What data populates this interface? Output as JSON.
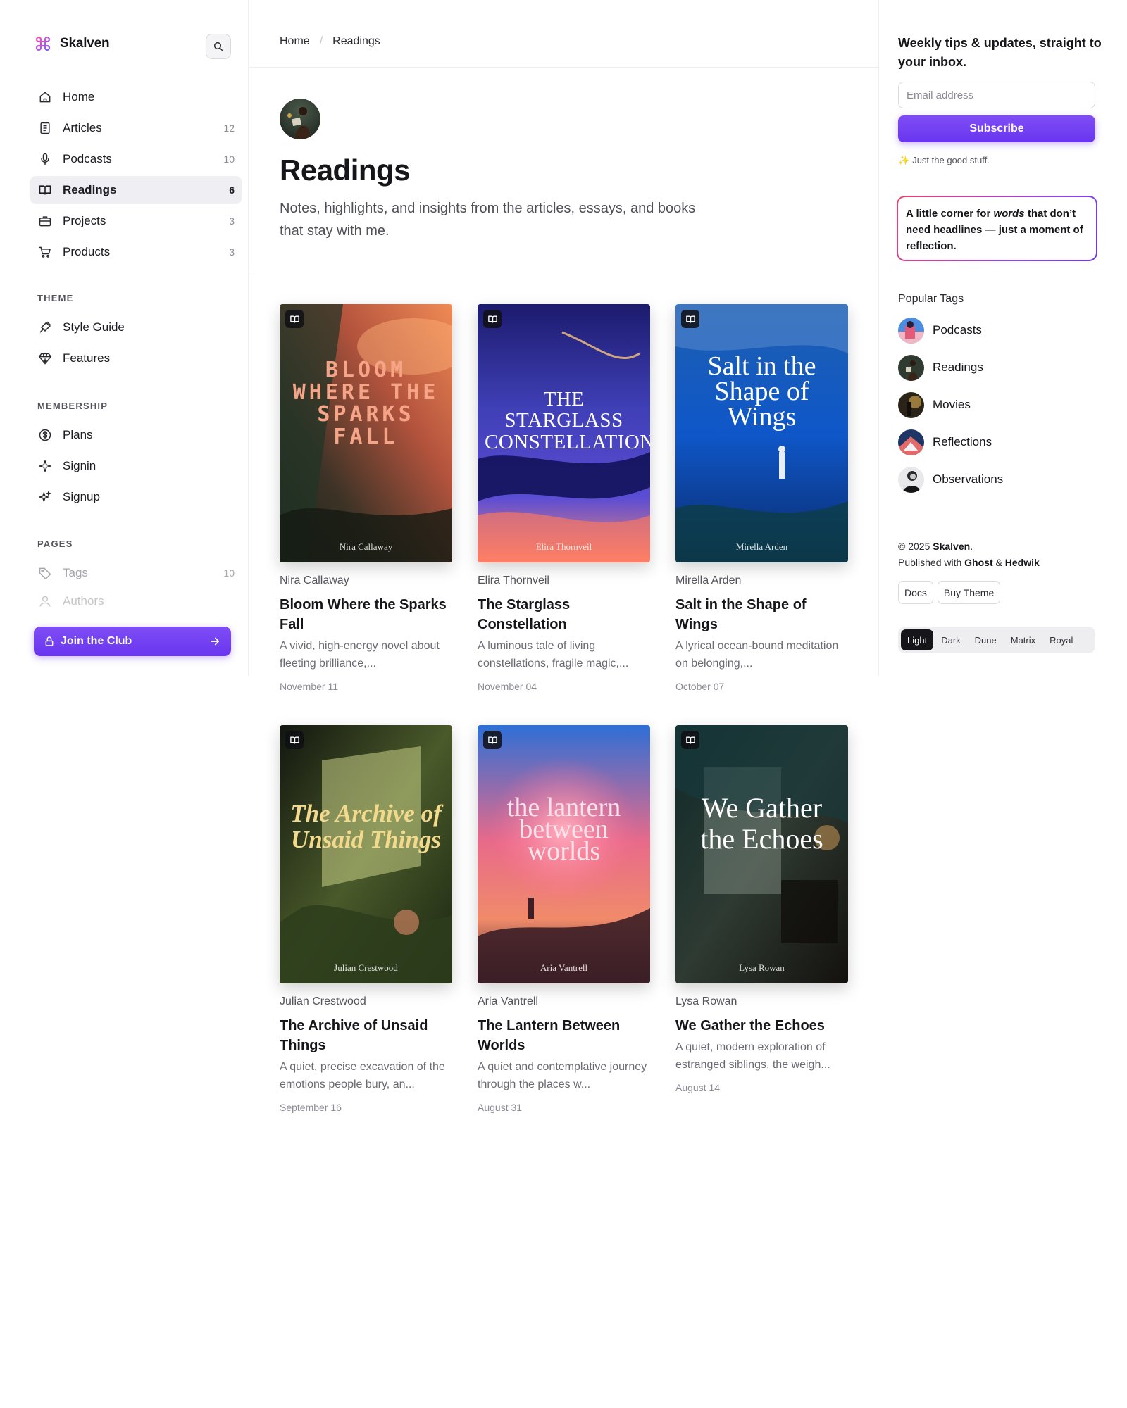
{
  "brand": {
    "name": "Skalven",
    "colors": {
      "accent": "#6a35ef",
      "logo_a": "#ff4fb0",
      "logo_b": "#7b5cff"
    }
  },
  "sidebar": {
    "nav": [
      {
        "label": "Home",
        "count": "",
        "icon": "home-icon",
        "active": false
      },
      {
        "label": "Articles",
        "count": "12",
        "icon": "document-icon",
        "active": false
      },
      {
        "label": "Podcasts",
        "count": "10",
        "icon": "microphone-icon",
        "active": false
      },
      {
        "label": "Readings",
        "count": "6",
        "icon": "book-open-icon",
        "active": true
      },
      {
        "label": "Projects",
        "count": "3",
        "icon": "briefcase-icon",
        "active": false
      },
      {
        "label": "Products",
        "count": "3",
        "icon": "cart-icon",
        "active": false
      }
    ],
    "theme_section": "THEME",
    "theme_items": [
      {
        "label": "Style Guide",
        "icon": "paint-tools-icon"
      },
      {
        "label": "Features",
        "icon": "diamond-icon"
      }
    ],
    "membership_section": "MEMBERSHIP",
    "membership_items": [
      {
        "label": "Plans",
        "icon": "dollar-circle-icon"
      },
      {
        "label": "Signin",
        "icon": "sparkle-icon"
      },
      {
        "label": "Signup",
        "icon": "sparkles-icon"
      }
    ],
    "pages_section": "PAGES",
    "pages_items": [
      {
        "label": "Tags",
        "count": "10",
        "icon": "tag-icon"
      },
      {
        "label": "Authors",
        "count": "",
        "icon": "user-icon"
      }
    ],
    "join_label": "Join the Club"
  },
  "main": {
    "breadcrumb": [
      "Home",
      "Readings"
    ],
    "title": "Readings",
    "description": "Notes, highlights, and insights from the articles, essays, and books that stay with me.",
    "cards": [
      {
        "author": "Nira Callaway",
        "title": "Bloom Where the Sparks Fall",
        "cover_title": "BLOOM WHERE THE SPARKS FALL",
        "excerpt": "A vivid, high-energy novel about fleeting brilliance,...",
        "date": "November 11"
      },
      {
        "author": "Elira Thornveil",
        "title": "The Starglass Constellation",
        "cover_title": "THE STARGLASS CONSTELLATION",
        "excerpt": "A luminous tale of living constellations, fragile magic,...",
        "date": "November 04"
      },
      {
        "author": "Mirella Arden",
        "title": "Salt in the Shape of Wings",
        "cover_title": "Salt in the Shape of Wings",
        "excerpt": "A lyrical ocean-bound meditation on belonging,...",
        "date": "October 07"
      },
      {
        "author": "Julian Crestwood",
        "title": "The Archive of Unsaid Things",
        "cover_title": "The Archive of Unsaid Things",
        "excerpt": "A quiet, precise excavation of the emotions people bury, an...",
        "date": "September 16"
      },
      {
        "author": "Aria Vantrell",
        "title": "The Lantern Between Worlds",
        "cover_title": "the lantern between worlds",
        "excerpt": "A quiet and contemplative journey through the places w...",
        "date": "August 31"
      },
      {
        "author": "Lysa Rowan",
        "title": "We Gather the Echoes",
        "cover_title": "We Gather the Echoes",
        "excerpt": "A quiet, modern exploration of estranged siblings, the weigh...",
        "date": "August 14"
      }
    ]
  },
  "rightbar": {
    "newsletter_title": "Weekly tips & updates, straight to your inbox.",
    "email_placeholder": "Email address",
    "subscribe_label": "Subscribe",
    "hint": "Just the good stuff.",
    "quote_pre": "A little corner for ",
    "quote_em": "words",
    "quote_post": " that don’t need headlines — just a moment of reflection.",
    "popular_tags_title": "Popular Tags",
    "tags": [
      "Podcasts",
      "Readings",
      "Movies",
      "Reflections",
      "Observations"
    ],
    "copyright_pre": "© 2025 ",
    "copyright_brand": "Skalven",
    "copyright_dot": ".",
    "published_pre": "Published with ",
    "published_ghost": "Ghost",
    "published_amp": " & ",
    "published_hedwik": "Hedwik",
    "footer_links": [
      "Docs",
      "Buy Theme"
    ],
    "themes": [
      "Light",
      "Dark",
      "Dune",
      "Matrix",
      "Royal"
    ],
    "active_theme": "Light"
  }
}
